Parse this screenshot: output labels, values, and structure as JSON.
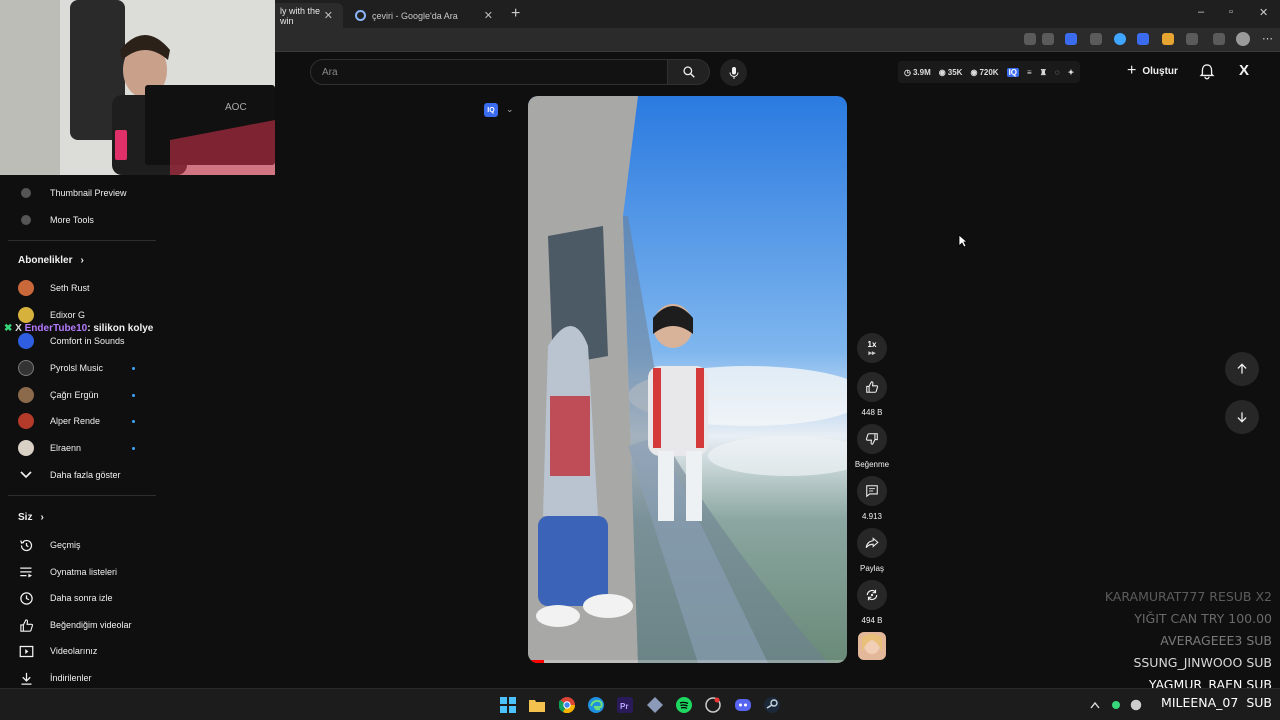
{
  "browser": {
    "tabs": [
      {
        "title": "ly with the win",
        "active": true
      },
      {
        "title": "çeviri - Google'da Ara",
        "active": false
      }
    ],
    "new_tab": "+",
    "window_controls": [
      "–",
      "▫",
      "✕"
    ]
  },
  "header": {
    "search_placeholder": "Ara",
    "stats": {
      "a": "3.9M",
      "b": "35K",
      "c": "720K"
    },
    "create_label": "Oluştur",
    "x_label": "X"
  },
  "sidebar": {
    "top_items": [
      {
        "label": "Thumbnail Preview",
        "icon": "tool-icon"
      },
      {
        "label": "More Tools",
        "icon": "tool-icon"
      }
    ],
    "subscriptions_title": "Abonelikler",
    "subscriptions": [
      {
        "label": "Seth Rust",
        "color": "#c9683a",
        "new": false
      },
      {
        "label": "Edixor G",
        "color": "#d6b23c",
        "new": false
      },
      {
        "label": "Comfort in Sounds",
        "color": "#2f5fe0",
        "new": false
      },
      {
        "label": "Pyrolsl Music",
        "color": "#222222",
        "new": true
      },
      {
        "label": "Çağrı Ergün",
        "color": "#8a6a4a",
        "new": true
      },
      {
        "label": "Alper Rende",
        "color": "#b43a2a",
        "new": true
      },
      {
        "label": "Elraenn",
        "color": "#d9d0c6",
        "new": true
      }
    ],
    "show_more": "Daha fazla göster",
    "you_title": "Siz",
    "you_items": [
      {
        "label": "Geçmiş"
      },
      {
        "label": "Oynatma listeleri"
      },
      {
        "label": "Daha sonra izle"
      },
      {
        "label": "Beğendiğim videolar"
      },
      {
        "label": "Videolarınız"
      },
      {
        "label": "İndirilenler"
      }
    ]
  },
  "chat": {
    "user": "EnderTube10",
    "message": ": silikon kolye"
  },
  "player": {
    "iq_badge": "IQ",
    "speed": "1x",
    "progress": 0.05
  },
  "actions": {
    "likes": "448 B",
    "dislike": "Beğenme",
    "comments": "4.913",
    "share": "Paylaş",
    "remix": "494 B"
  },
  "overlay_subs": [
    {
      "name": "KARAMURAT777",
      "type": "RESUB X2",
      "color": "#5c5c5c"
    },
    {
      "name": "YIĞIT CAN",
      "type": "TRY 100.00",
      "color": "#6a6a6a"
    },
    {
      "name": "AVERAGEEE3",
      "type": "SUB",
      "color": "#7a7a7a"
    },
    {
      "name": "SSUNG_JINWOOO",
      "type": "SUB",
      "color": "#d8d8d8"
    },
    {
      "name": "YAGMUR_RAEN",
      "type": "SUB",
      "color": "#ffffff"
    },
    {
      "name": "MILEENA_07",
      "type": "SUB",
      "color": "#ffffff"
    }
  ]
}
